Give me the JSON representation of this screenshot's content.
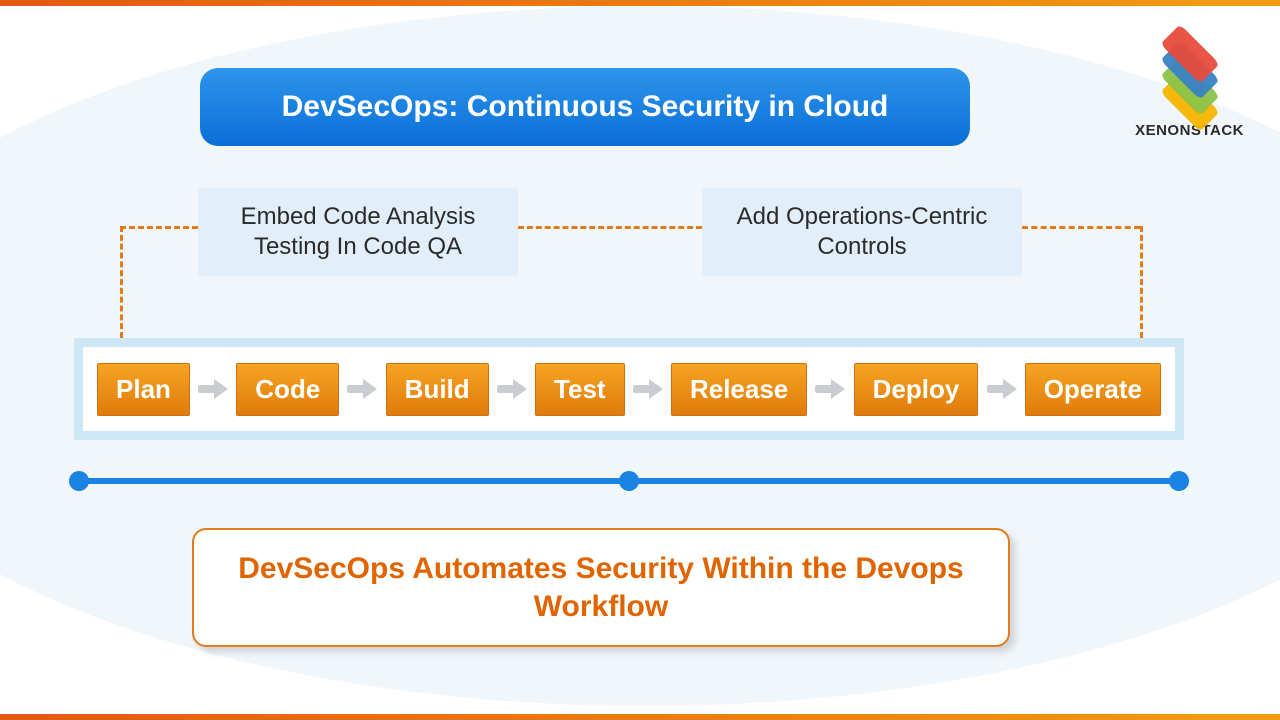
{
  "brand": {
    "name": "XENONSTACK"
  },
  "title": "DevSecOps:  Continuous Security in Cloud",
  "callouts": {
    "left": "Embed Code Analysis Testing In Code QA",
    "right": "Add Operations-Centric Controls"
  },
  "workflow": [
    "Plan",
    "Code",
    "Build",
    "Test",
    "Release",
    "Deploy",
    "Operate"
  ],
  "banner": "DevSecOps Automates Security Within the Devops Workflow",
  "colors": {
    "accent_orange": "#e37b1a",
    "title_blue_top": "#2d95ea",
    "title_blue_bot": "#0a6fd8",
    "timeline_blue": "#1a82e2",
    "stage_top": "#f6a423",
    "stage_bot": "#e07b0b",
    "callout_bg": "#e2effa"
  }
}
